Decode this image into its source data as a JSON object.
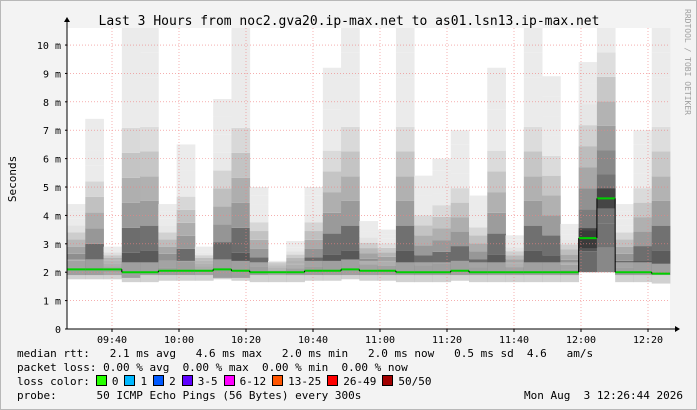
{
  "chart_data": {
    "type": "area",
    "title": "Last 3 Hours from noc2.gva20.ip-max.net to as01.lsn13.ip-max.net",
    "ylabel": "Seconds",
    "y_unit": "ms",
    "ylim": [
      0,
      10.6
    ],
    "yticks": [
      0,
      1,
      2,
      3,
      4,
      5,
      6,
      7,
      8,
      9,
      10
    ],
    "ytick_labels": [
      "0",
      "1 m",
      "2 m",
      "3 m",
      "4 m",
      "5 m",
      "6 m",
      "7 m",
      "8 m",
      "9 m",
      "10 m"
    ],
    "xticks": [
      "09:40",
      "10:00",
      "10:20",
      "10:40",
      "11:00",
      "11:20",
      "11:40",
      "12:00",
      "12:20"
    ],
    "grid": true,
    "smoke": [
      {
        "min": 1.9,
        "max": 4.4
      },
      {
        "min": 1.9,
        "max": 7.4
      },
      {
        "min": 1.9,
        "max": 2.9
      },
      {
        "min": 1.8,
        "max": 10.6
      },
      {
        "min": 1.9,
        "max": 10.6
      },
      {
        "min": 1.9,
        "max": 4.4
      },
      {
        "min": 1.9,
        "max": 6.5
      },
      {
        "min": 1.9,
        "max": 2.9
      },
      {
        "min": 1.8,
        "max": 8.1
      },
      {
        "min": 1.8,
        "max": 10.6
      },
      {
        "min": 1.9,
        "max": 5.0
      },
      {
        "min": 1.9,
        "max": 2.4
      },
      {
        "min": 1.9,
        "max": 3.1
      },
      {
        "min": 1.9,
        "max": 5.0
      },
      {
        "min": 1.9,
        "max": 9.2
      },
      {
        "min": 1.9,
        "max": 10.6
      },
      {
        "min": 1.9,
        "max": 3.8
      },
      {
        "min": 1.9,
        "max": 3.5
      },
      {
        "min": 1.9,
        "max": 10.6
      },
      {
        "min": 1.9,
        "max": 5.4
      },
      {
        "min": 1.9,
        "max": 6.0
      },
      {
        "min": 1.9,
        "max": 7.0
      },
      {
        "min": 1.9,
        "max": 4.7
      },
      {
        "min": 1.9,
        "max": 9.2
      },
      {
        "min": 1.9,
        "max": 3.3
      },
      {
        "min": 1.9,
        "max": 10.6
      },
      {
        "min": 1.9,
        "max": 8.9
      },
      {
        "min": 1.9,
        "max": 3.7
      },
      {
        "min": 2.0,
        "max": 9.4
      },
      {
        "min": 2.0,
        "max": 10.6
      },
      {
        "min": 1.9,
        "max": 4.4
      },
      {
        "min": 1.9,
        "max": 7.0
      },
      {
        "min": 1.9,
        "max": 10.6
      }
    ],
    "median_ms": [
      2.1,
      2.1,
      2.1,
      2.0,
      2.0,
      2.05,
      2.05,
      2.05,
      2.1,
      2.05,
      2.0,
      2.0,
      2.0,
      2.05,
      2.05,
      2.1,
      2.05,
      2.05,
      2.0,
      2.0,
      2.0,
      2.05,
      2.0,
      2.0,
      2.0,
      2.0,
      2.0,
      2.0,
      3.2,
      4.6,
      2.0,
      2.0,
      1.95
    ],
    "loss_percent": [
      0,
      0,
      0,
      0,
      0,
      0,
      0,
      0,
      0,
      0,
      0,
      0,
      0,
      0,
      0,
      0,
      0,
      0,
      0,
      0,
      0,
      0,
      0,
      0,
      0,
      0,
      0,
      0,
      0,
      0,
      0,
      0,
      0
    ],
    "colors": {
      "median": "#00d000",
      "grid": "#f08080",
      "smoke_min": "#e0e0e0",
      "smoke_max": "#000000",
      "axis": "#000000",
      "background": "#f3f3f3"
    }
  },
  "side_label": "RRDTOOL / TOBI OETIKER",
  "stats": {
    "median_rtt": "median rtt:   2.1 ms avg   4.6 ms max   2.0 ms min   2.0 ms now   0.5 ms sd  4.6   am/s",
    "packet_loss": "packet loss: 0.00 % avg  0.00 % max  0.00 % min  0.00 % now"
  },
  "loss_legend": {
    "label": "loss color:",
    "items": [
      {
        "label": "0",
        "color": "#26ff00"
      },
      {
        "label": "1",
        "color": "#00b8ff"
      },
      {
        "label": "2",
        "color": "#0059ff"
      },
      {
        "label": "3-5",
        "color": "#5e00ff"
      },
      {
        "label": "6-12",
        "color": "#ff00ff"
      },
      {
        "label": "13-25",
        "color": "#ff5500"
      },
      {
        "label": "26-49",
        "color": "#ff0000"
      },
      {
        "label": "50/50",
        "color": "#a10000"
      }
    ]
  },
  "probe": {
    "label": "probe:",
    "text": "50 ICMP Echo Pings (56 Bytes) every 300s",
    "date": "Mon Aug  3 12:26:44 2026"
  }
}
